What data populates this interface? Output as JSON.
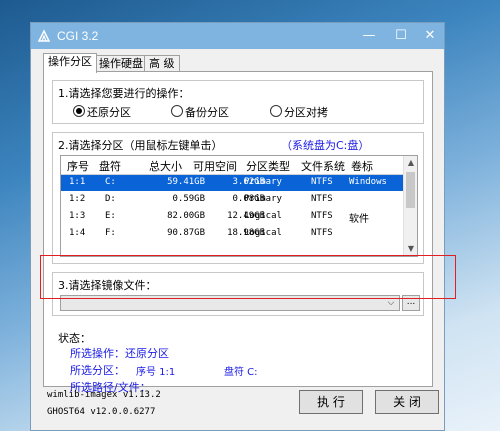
{
  "window": {
    "title": "CGI 3.2",
    "min": "—",
    "max": "☐",
    "close": "✕"
  },
  "tabs": [
    {
      "label": "操作分区"
    },
    {
      "label": "操作硬盘"
    },
    {
      "label": "高 级"
    }
  ],
  "section1": {
    "label": "1.请选择您要进行的操作：",
    "options": [
      {
        "label": "还原分区",
        "selected": true
      },
      {
        "label": "备份分区",
        "selected": false
      },
      {
        "label": "分区对拷",
        "selected": false
      }
    ]
  },
  "section2": {
    "label": "2.请选择分区（用鼠标左键单击）",
    "system_disk": "（系统盘为C:盘）",
    "columns": [
      "序号",
      "盘符",
      "总大小",
      "可用空间",
      "分区类型",
      "文件系统",
      "卷标"
    ],
    "rows": [
      {
        "no": "1:1",
        "drive": "C:",
        "total": "59.41GB",
        "free": "3.62GB",
        "type": "Primary",
        "fs": "NTFS",
        "label": "Windows",
        "selected": true
      },
      {
        "no": "1:2",
        "drive": "D:",
        "total": "0.59GB",
        "free": "0.08GB",
        "type": "Primary",
        "fs": "NTFS",
        "label": "",
        "selected": false
      },
      {
        "no": "1:3",
        "drive": "E:",
        "total": "82.00GB",
        "free": "12.49GB",
        "type": "Logical",
        "fs": "NTFS",
        "label": "软件",
        "selected": false
      },
      {
        "no": "1:4",
        "drive": "F:",
        "total": "90.87GB",
        "free": "18.98GB",
        "type": "Logical",
        "fs": "NTFS",
        "label": "",
        "selected": false
      }
    ]
  },
  "section3": {
    "label": "3.请选择镜像文件：",
    "value": "",
    "browse_label": "..."
  },
  "status": {
    "title": "状态：",
    "operation": "所选操作：还原分区",
    "partition": "所选分区：",
    "partition_no": "序号 1:1",
    "partition_drive": "盘符 C:",
    "path": "所选路径/文件："
  },
  "footer": {
    "version1": "wimlib-imagex v1.13.2",
    "version2": "GHOST64 v12.0.0.6277",
    "run_label": "执 行",
    "close_label": "关 闭"
  },
  "colors": {
    "accent": "#0a64d8",
    "info_blue": "#1a1ae6",
    "highlight_red": "#e02020",
    "titlebar": "#7fb4e0"
  }
}
